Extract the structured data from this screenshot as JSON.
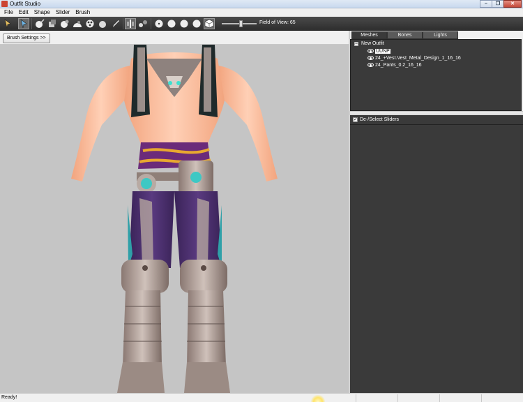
{
  "window": {
    "title": "Outfit Studio"
  },
  "menu": [
    "File",
    "Edit",
    "Shape",
    "Slider",
    "Brush"
  ],
  "toolbar": {
    "fov_label": "Field of View: 65",
    "fov_value": 65
  },
  "brush": {
    "settings_label": "Brush Settings >>"
  },
  "tabs": [
    {
      "label": "Meshes",
      "active": true
    },
    {
      "label": "Bones",
      "active": false
    },
    {
      "label": "Lights",
      "active": false
    }
  ],
  "meshes": {
    "root": "New Outfit",
    "items": [
      {
        "label": "UUNP",
        "selected": true
      },
      {
        "label": "24_+Vest.Vest_Metal_Design_1_16_16",
        "selected": false
      },
      {
        "label": "24_Pants_0.2_16_16",
        "selected": false
      }
    ]
  },
  "sliders": {
    "header": "De-/Select Sliders",
    "checked": true
  },
  "status": {
    "text": "Ready!"
  },
  "colors": {
    "viewport_bg": "#c5c5c5",
    "panel_bg": "#3a3a3a",
    "toolbar_bg": "#3a3a3a"
  }
}
